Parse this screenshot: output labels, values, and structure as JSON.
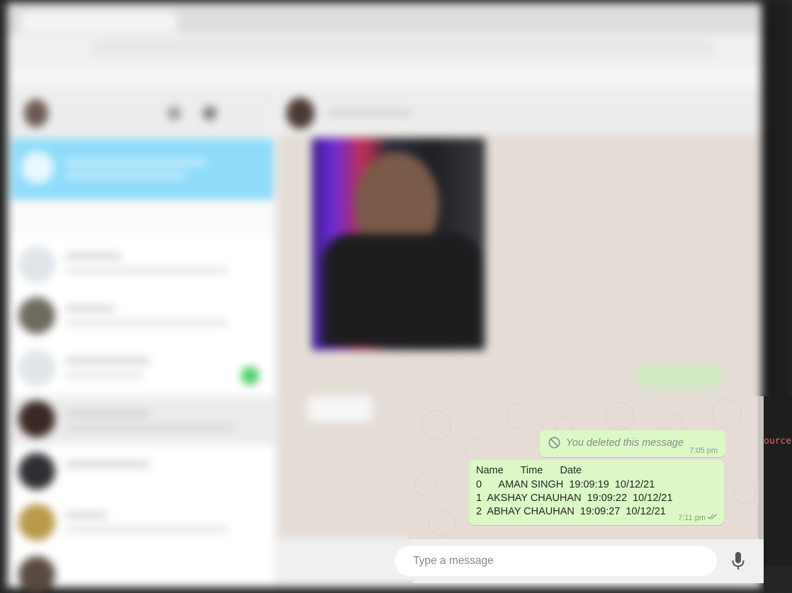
{
  "chat": {
    "deleted_message": {
      "text": "You deleted this message",
      "time": "7:05 pm"
    },
    "table_message": {
      "lines": [
        "Name      Time      Date",
        "0      AMAN SINGH  19:09:19  10/12/21",
        "1  AKSHAY CHAUHAN  19:09:22  10/12/21",
        "2  ABHAY CHAUHAN  19:09:27  10/12/21"
      ],
      "time": "7:11 pm",
      "status": "read"
    }
  },
  "composer": {
    "placeholder": "Type a message",
    "visible_placeholder_fragment": "ssage"
  },
  "editor": {
    "visible_text": "ource"
  },
  "colors": {
    "outgoing_bubble": "#dcf8c6",
    "chat_background": "#e5ddd5",
    "notice_banner": "#8fdcfa",
    "read_ticks": "#4fc3f7"
  },
  "icons": {
    "deleted": "ban-icon",
    "read_receipt": "double-check-icon",
    "voice": "microphone-icon"
  }
}
